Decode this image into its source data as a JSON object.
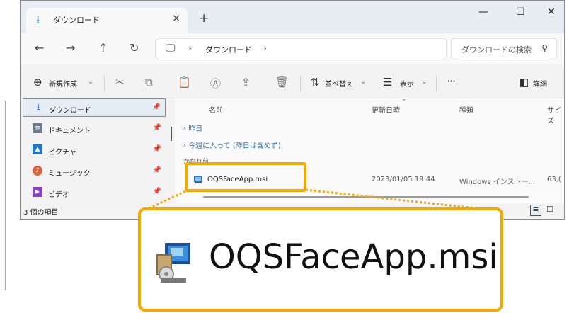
{
  "window": {
    "tab_title": "ダウンロード",
    "tab_close": "×",
    "new_tab": "+",
    "minimize": "—",
    "maximize": "☐",
    "close": "✕"
  },
  "address": {
    "path_label": "ダウンロード",
    "search_placeholder": "ダウンロードの検索"
  },
  "commands": {
    "new": "新規作成",
    "sort": "並べ替え",
    "view": "表示",
    "more": "···",
    "details": "詳細"
  },
  "sidebar": {
    "items": [
      {
        "label": "ダウンロード",
        "icon": "download-icon",
        "selected": true
      },
      {
        "label": "ドキュメント",
        "icon": "document-icon"
      },
      {
        "label": "ピクチャ",
        "icon": "pictures-icon"
      },
      {
        "label": "ミュージック",
        "icon": "music-icon"
      },
      {
        "label": "ビデオ",
        "icon": "video-icon"
      }
    ]
  },
  "columns": {
    "name": "名前",
    "modified": "更新日時",
    "type": "種類",
    "size": "サイズ"
  },
  "groups": {
    "yesterday": "昨日",
    "this_week": "今週に入って (昨日は含めず)",
    "earlier": "かなり前"
  },
  "file": {
    "name": "OQSFaceApp.msi",
    "modified": "2023/01/05 19:44",
    "type": "Windows インストー...",
    "size": "63,("
  },
  "status": {
    "count": "3 個の項目"
  },
  "callout": {
    "filename": "OQSFaceApp.msi"
  },
  "colors": {
    "highlight": "#f5a800",
    "accent": "#1e78d2"
  }
}
